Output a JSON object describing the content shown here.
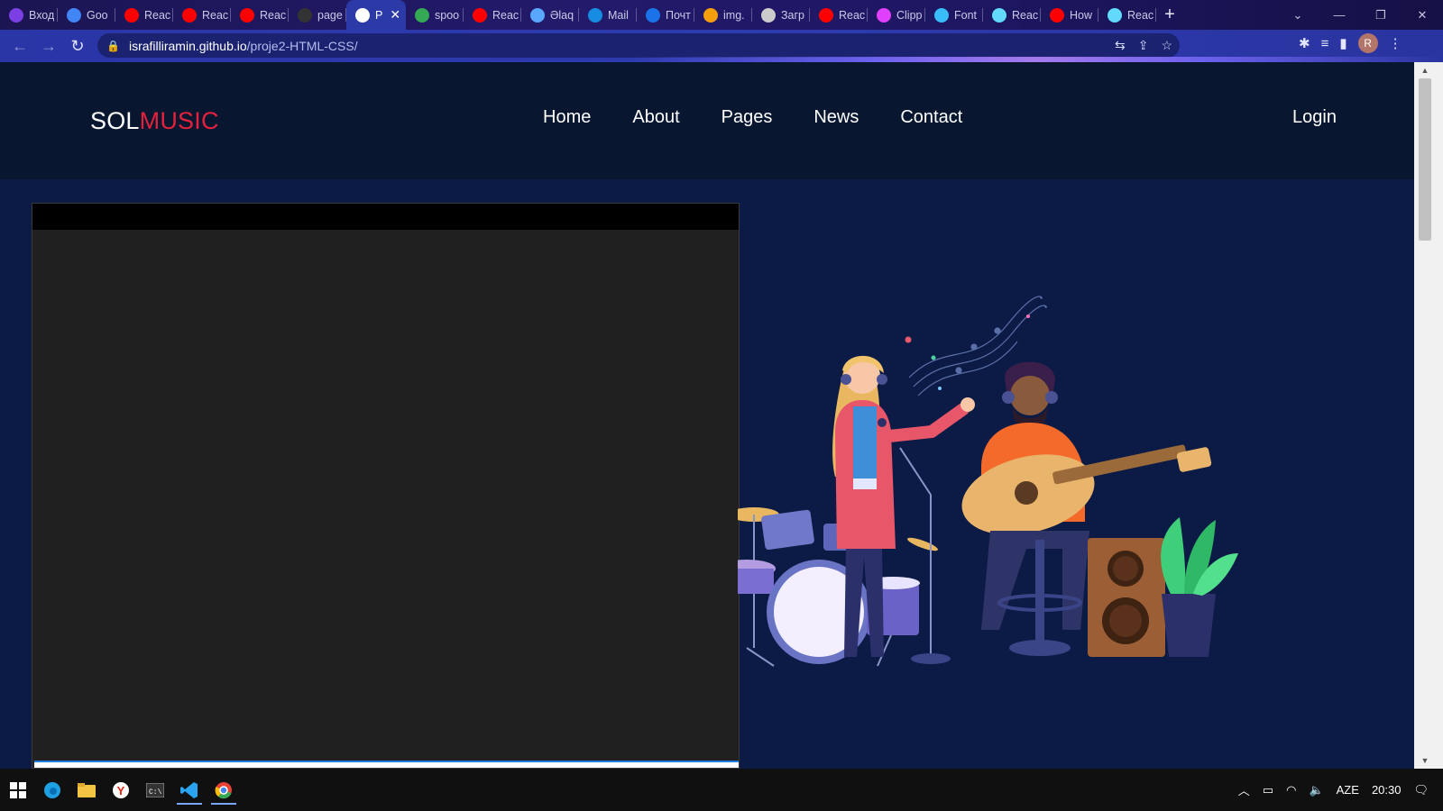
{
  "browser": {
    "tabs": [
      {
        "label": "Вход",
        "icon": "instagram-icon",
        "color": "#7b3fe4"
      },
      {
        "label": "Goo",
        "icon": "google-translate-icon",
        "color": "#4285f4"
      },
      {
        "label": "Reac",
        "icon": "youtube-icon",
        "color": "#ff0000"
      },
      {
        "label": "Reac",
        "icon": "youtube-icon",
        "color": "#ff0000"
      },
      {
        "label": "Reac",
        "icon": "youtube-icon",
        "color": "#ff0000"
      },
      {
        "label": "page",
        "icon": "github-icon",
        "color": "#333333"
      },
      {
        "label": "P",
        "icon": "globe-icon",
        "color": "#ffffff",
        "active": true
      },
      {
        "label": "spoo",
        "icon": "google-icon",
        "color": "#34a853"
      },
      {
        "label": "Reac",
        "icon": "youtube-icon",
        "color": "#ff0000"
      },
      {
        "label": "Əlaq",
        "icon": "feather-icon",
        "color": "#5aa7ff"
      },
      {
        "label": "Mail",
        "icon": "mail-at-icon",
        "color": "#168de2"
      },
      {
        "label": "Почт",
        "icon": "mail-icon",
        "color": "#1a73e8"
      },
      {
        "label": "img.",
        "icon": "cloud-icon",
        "color": "#f59e0b"
      },
      {
        "label": "Загр",
        "icon": "layers-icon",
        "color": "#cccccc"
      },
      {
        "label": "Reac",
        "icon": "youtube-icon",
        "color": "#ff0000"
      },
      {
        "label": "Clipp",
        "icon": "clippy-icon",
        "color": "#e040fb"
      },
      {
        "label": "Font",
        "icon": "tailwind-icon",
        "color": "#38bdf8"
      },
      {
        "label": "Reac",
        "icon": "react-icon",
        "color": "#61dafb"
      },
      {
        "label": "How",
        "icon": "youtube-icon",
        "color": "#ff0000"
      },
      {
        "label": "Reac",
        "icon": "react-icon",
        "color": "#61dafb"
      }
    ],
    "new_tab": "+",
    "url_host": "israfilliramin.github.io",
    "url_path": "/proje2-HTML-CSS/",
    "profile_initial": "R"
  },
  "site": {
    "logo_sol": "SOL",
    "logo_music": "MUSIC",
    "nav": [
      "Home",
      "About",
      "Pages",
      "News",
      "Contact"
    ],
    "login": "Login"
  },
  "taskbar": {
    "lang": "AZE",
    "time": "20:30"
  },
  "colors": {
    "accent_red": "#e3213d",
    "page_bg": "#0b1b45",
    "header_bg": "#081630"
  }
}
